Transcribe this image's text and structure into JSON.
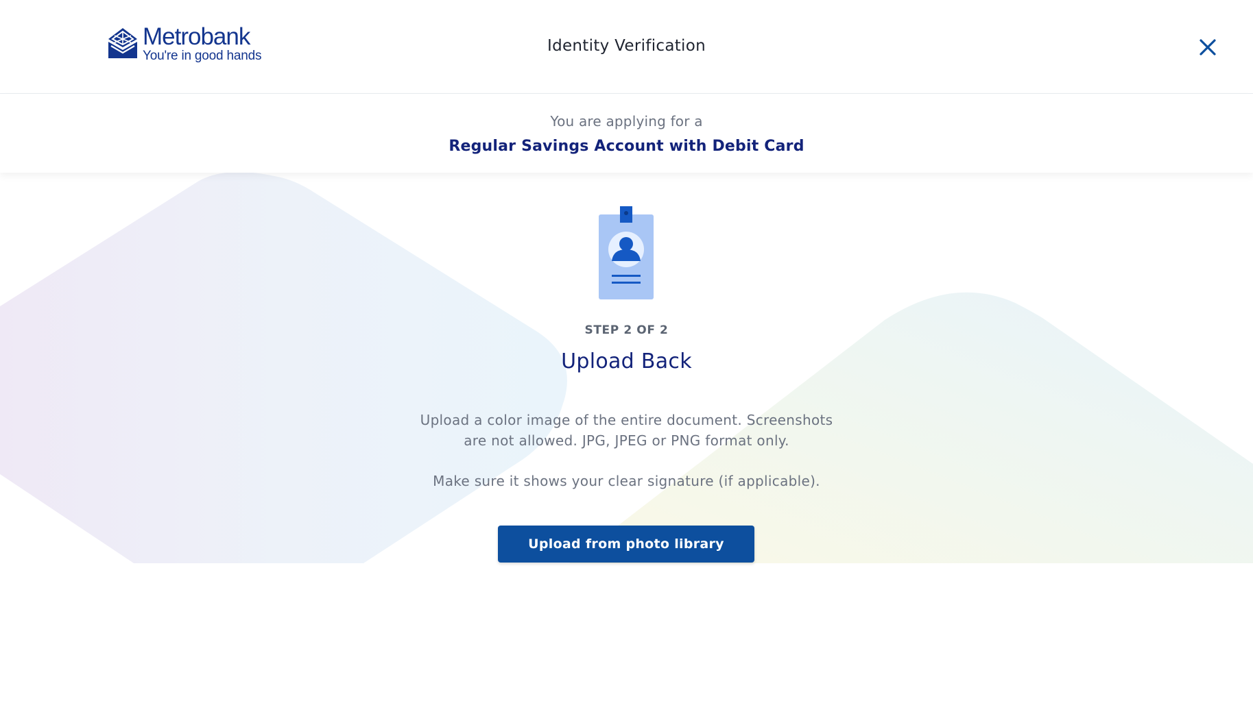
{
  "brand": {
    "name": "Metrobank",
    "tagline": "You're in good hands"
  },
  "header": {
    "title": "Identity Verification",
    "close_icon": "close-icon"
  },
  "application": {
    "intro": "You are applying for a",
    "product": "Regular Savings Account with Debit Card"
  },
  "step": {
    "label": "STEP 2 OF 2",
    "title": "Upload Back",
    "icon": "id-card-icon",
    "description": "Upload a color image of the entire document. Screenshots are not allowed. JPG, JPEG or PNG format only.",
    "note": "Make sure it shows your clear signature (if applicable)."
  },
  "actions": {
    "upload_label": "Upload from photo library"
  },
  "colors": {
    "brand_blue": "#13358e",
    "title_navy": "#13237a",
    "button_blue": "#0d4f9e",
    "icon_light": "#a9c6f5",
    "icon_dark": "#1559c4"
  }
}
